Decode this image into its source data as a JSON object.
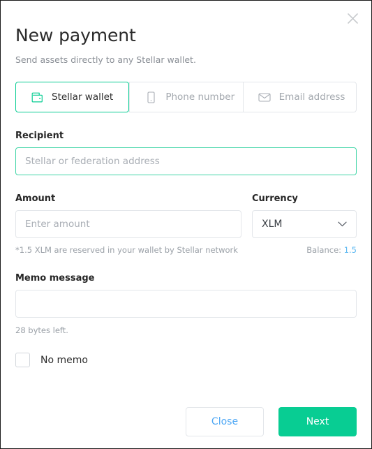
{
  "dialog": {
    "title": "New payment",
    "subtitle": "Send assets directly to any Stellar wallet.",
    "close_icon": "close-icon"
  },
  "tabs": [
    {
      "label": "Stellar wallet",
      "icon": "wallet-icon",
      "active": true
    },
    {
      "label": "Phone number",
      "icon": "phone-icon",
      "active": false
    },
    {
      "label": "Email address",
      "icon": "envelope-icon",
      "active": false
    }
  ],
  "recipient": {
    "label": "Recipient",
    "placeholder": "Stellar or federation address",
    "value": "",
    "focused": true
  },
  "amount": {
    "label": "Amount",
    "placeholder": "Enter amount",
    "value": ""
  },
  "currency": {
    "label": "Currency",
    "selected": "XLM",
    "options": [
      "XLM"
    ],
    "chevron_icon": "chevron-down-icon"
  },
  "notes": {
    "reserve_note": "*1.5 XLM are reserved in your wallet by Stellar network",
    "balance_label": "Balance:",
    "balance_value": "1.5"
  },
  "memo": {
    "label": "Memo message",
    "value": "",
    "bytes_left": "28 bytes left.",
    "no_memo_label": "No memo",
    "no_memo_checked": false
  },
  "footer": {
    "close_label": "Close",
    "next_label": "Next"
  },
  "colors": {
    "accent_green": "#08cd93",
    "link_blue": "#4fa8f5",
    "balance_blue": "#5cb8f2",
    "border_gray": "#e3e6ea",
    "muted_text": "#9aa0a7"
  }
}
